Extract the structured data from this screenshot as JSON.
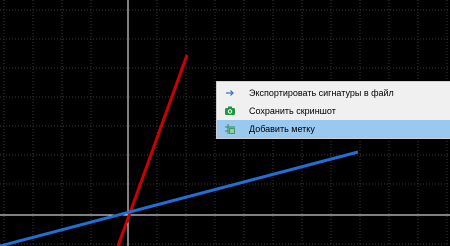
{
  "plot": {
    "background": "#000000",
    "grid_color": "#3a3a3a",
    "axis_color": "#ffffff",
    "lines": [
      {
        "color": "#cc0000",
        "description": "steep line"
      },
      {
        "color": "#1f6fd6",
        "description": "shallow line"
      }
    ]
  },
  "context_menu": {
    "items": [
      {
        "label": "Экспортировать сигнатуры в файл",
        "icon": "arrow-right-icon",
        "highlighted": false
      },
      {
        "label": "Сохранить скриншот",
        "icon": "camera-icon",
        "highlighted": false
      },
      {
        "label": "Добавить метку",
        "icon": "add-marker-icon",
        "highlighted": true
      }
    ],
    "highlight_color": "#99c9ef"
  }
}
